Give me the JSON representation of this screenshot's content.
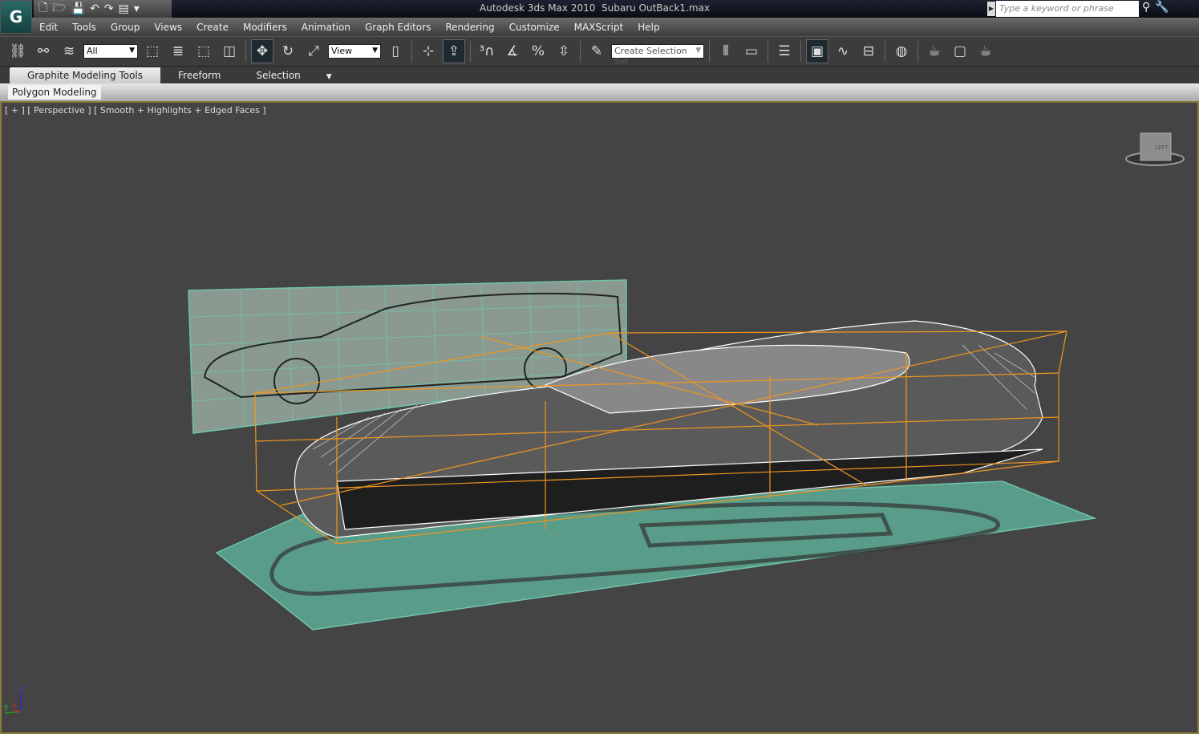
{
  "titlebar": {
    "app": "Autodesk 3ds Max  2010",
    "file": "Subaru OutBack1.max",
    "search_placeholder": "Type a keyword or phrase"
  },
  "menu": [
    "Edit",
    "Tools",
    "Group",
    "Views",
    "Create",
    "Modifiers",
    "Animation",
    "Graph Editors",
    "Rendering",
    "Customize",
    "MAXScript",
    "Help"
  ],
  "toolbar": {
    "selection_filter": "All",
    "ref_coord": "View",
    "selection_set": "Create Selection Set"
  },
  "ribbon": {
    "tabs": [
      "Graphite Modeling Tools",
      "Freeform",
      "Selection"
    ],
    "panel": "Polygon Modeling"
  },
  "viewport": {
    "label": "[ + ] [ Perspective ] [ Smooth + Highlights + Edged Faces ]",
    "viewcube_face": "LEFT",
    "axis": {
      "z": "z",
      "y": "y",
      "x": "x"
    }
  },
  "colors": {
    "cage": "#f0961e",
    "plane": "#5fa893",
    "border": "#8a7b3a"
  }
}
